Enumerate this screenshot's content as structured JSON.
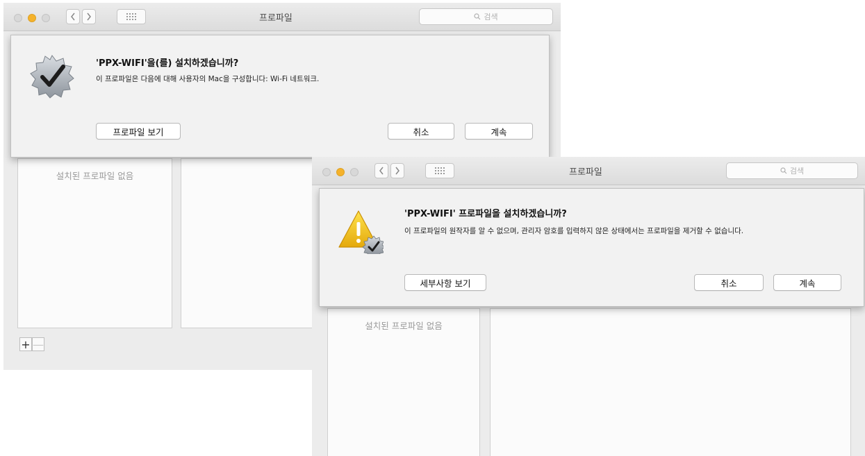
{
  "window1": {
    "title": "프로파일",
    "search_placeholder": "검색",
    "empty_list_text": "설치된 프로파일 없음",
    "add_label": "+",
    "remove_label": "—",
    "dialog": {
      "icon": "verified-checkmark-badge-icon",
      "title": "'PPX-WIFI'을(를) 설치하겠습니까?",
      "message": "이 프로파일은 다음에 대해 사용자의 Mac을 구성합니다: Wi-Fi 네트워크.",
      "view_profile_label": "프로파일 보기",
      "cancel_label": "취소",
      "continue_label": "계속"
    }
  },
  "window2": {
    "title": "프로파일",
    "search_placeholder": "검색",
    "empty_list_text": "설치된 프로파일 없음",
    "dialog": {
      "icon": "warning-badge-icon",
      "title": "'PPX-WIFI' 프로파일을 설치하겠습니까?",
      "message": "이 프로파일의 원작자를 알 수 없으며, 관리자 암호를 입력하지 않은 상태에서는 프로파일을 제거할 수 없습니다.",
      "details_label": "세부사항 보기",
      "cancel_label": "취소",
      "continue_label": "계속"
    }
  },
  "colors": {
    "traffic_yellow": "#f5b22b",
    "traffic_gray": "#d8d8d8",
    "window_bg": "#ececec",
    "sheet_bg": "#f2f2f2"
  }
}
